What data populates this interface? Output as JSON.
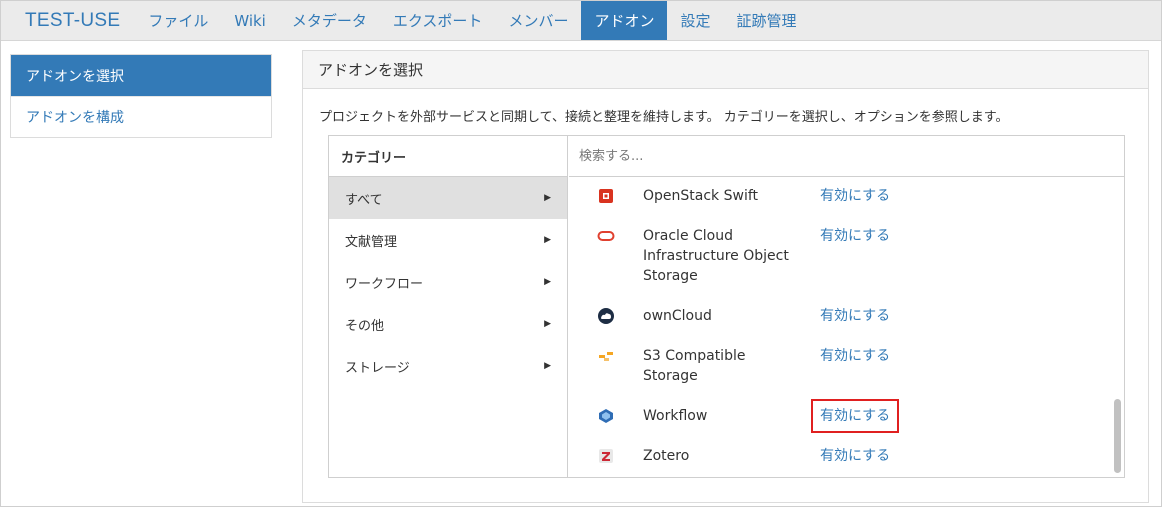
{
  "nav": {
    "brand": "TEST-USE",
    "items": [
      "ファイル",
      "Wiki",
      "メタデータ",
      "エクスポート",
      "メンバー",
      "アドオン",
      "設定",
      "証跡管理"
    ],
    "active_index": 5
  },
  "sidebar": {
    "items": [
      {
        "label": "アドオンを選択",
        "active": true
      },
      {
        "label": "アドオンを構成",
        "active": false
      }
    ]
  },
  "panel": {
    "title": "アドオンを選択",
    "description": "プロジェクトを外部サービスと同期して、接続と整理を維持します。 カテゴリーを選択し、オプションを参照します。"
  },
  "picker": {
    "category_header": "カテゴリー",
    "search_placeholder": "検索する...",
    "categories": [
      {
        "label": "すべて",
        "active": true
      },
      {
        "label": "文献管理",
        "active": false
      },
      {
        "label": "ワークフロー",
        "active": false
      },
      {
        "label": "その他",
        "active": false
      },
      {
        "label": "ストレージ",
        "active": false
      }
    ],
    "addons": [
      {
        "name": "OpenStack Swift",
        "action": "有効にする",
        "icon": "openstack-icon",
        "color": "#d9331f"
      },
      {
        "name": "Oracle Cloud Infrastructure Object Storage",
        "action": "有効にする",
        "icon": "oracle-icon",
        "color": "#e0402f"
      },
      {
        "name": "ownCloud",
        "action": "有効にする",
        "icon": "owncloud-icon",
        "color": "#1d2d44"
      },
      {
        "name": "S3 Compatible Storage",
        "action": "有効にする",
        "icon": "s3-icon",
        "color": "#f5a623"
      },
      {
        "name": "Workflow",
        "action": "有効にする",
        "icon": "workflow-icon",
        "color": "#2f6db5"
      },
      {
        "name": "Zotero",
        "action": "有効にする",
        "icon": "zotero-icon",
        "color": "#cc2936"
      }
    ],
    "highlighted_addon": "Workflow"
  }
}
